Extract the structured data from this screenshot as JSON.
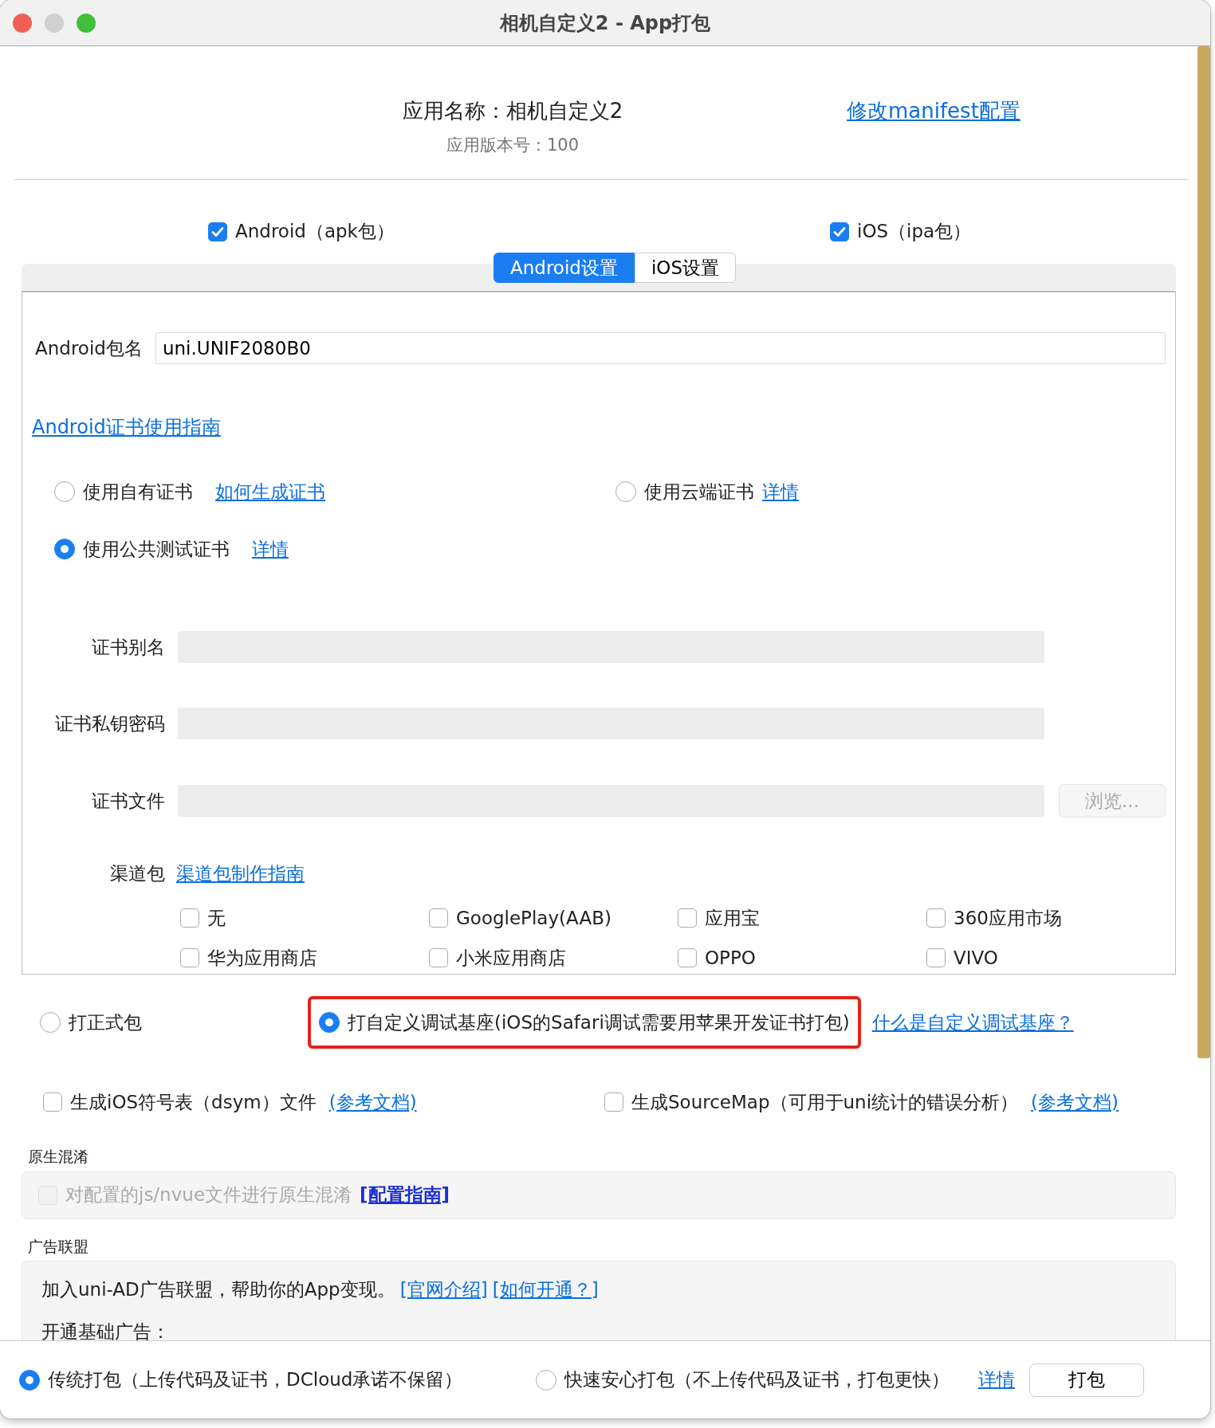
{
  "window": {
    "title": "相机自定义2 - App打包"
  },
  "app": {
    "name": "应用名称：相机自定义2",
    "version": "应用版本号：100",
    "manifest_link": "修改manifest配置"
  },
  "platforms": [
    {
      "label": "Android（apk包）",
      "checked": true
    },
    {
      "label": "iOS（ipa包）",
      "checked": true
    }
  ],
  "tabs": [
    {
      "label": "Android设置",
      "selected": true
    },
    {
      "label": "iOS设置",
      "selected": false
    }
  ],
  "android": {
    "package_label": "Android包名",
    "package_value": "uni.UNIF2080B0",
    "cert_guide": "Android证书使用指南",
    "cert_options": [
      {
        "label": "使用自有证书",
        "link": "如何生成证书",
        "selected": false
      },
      {
        "label": "使用云端证书",
        "link": "详情",
        "selected": false
      },
      {
        "label": "使用公共测试证书",
        "link": "详情",
        "selected": true
      }
    ],
    "cert_fields": [
      {
        "label": "证书别名",
        "disabled": true
      },
      {
        "label": "证书私钥密码",
        "disabled": true
      },
      {
        "label": "证书文件",
        "disabled": true,
        "button": "浏览..."
      }
    ],
    "channel_label": "渠道包",
    "channel_link": "渠道包制作指南",
    "channels": [
      {
        "label": "无",
        "checked": false
      },
      {
        "label": "GooglePlay(AAB)",
        "checked": false
      },
      {
        "label": "应用宝",
        "checked": false
      },
      {
        "label": "360应用市场",
        "checked": false
      },
      {
        "label": "华为应用商店",
        "checked": false
      },
      {
        "label": "小米应用商店",
        "checked": false
      },
      {
        "label": "OPPO",
        "checked": false
      },
      {
        "label": "VIVO",
        "checked": false
      }
    ]
  },
  "package_types": [
    {
      "label": "打正式包",
      "selected": false,
      "highlighted": false
    },
    {
      "label": "打自定义调试基座(iOS的Safari调试需要用苹果开发证书打包)",
      "selected": true,
      "highlighted": true
    }
  ],
  "package_link": "什么是自定义调试基座？",
  "options": [
    {
      "label": "生成iOS符号表（dsym）文件",
      "link": "(参考文档)",
      "checked": false
    },
    {
      "label": "生成SourceMap（可用于uni统计的错误分析）",
      "link": "(参考文档)",
      "checked": false
    }
  ],
  "obfuscation": {
    "title": "原生混淆",
    "label": "对配置的js/nvue文件进行原生混淆",
    "link": "[配置指南]",
    "checked": false,
    "disabled": true
  },
  "ads": {
    "title": "广告联盟",
    "text": "加入uni-AD广告联盟，帮助你的App变现。",
    "links": [
      "[官网介绍]",
      "[如何开通？]"
    ],
    "subtitle": "开通基础广告："
  },
  "footer": {
    "modes": [
      {
        "label": "传统打包（上传代码及证书，DCloud承诺不保留）",
        "selected": true
      },
      {
        "label": "快速安心打包（不上传代码及证书，打包更快）",
        "selected": false
      }
    ],
    "link": "详情",
    "button": "打包"
  }
}
